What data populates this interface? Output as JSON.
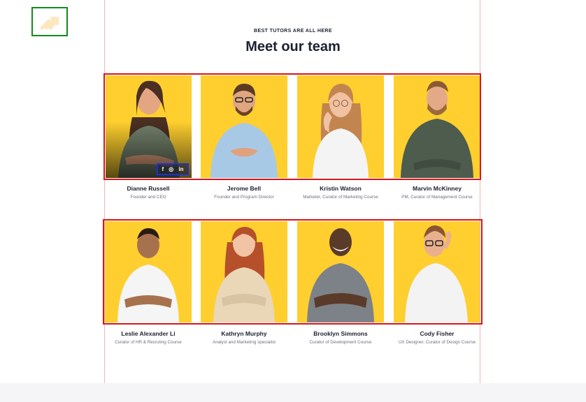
{
  "header": {
    "eyebrow": "BEST TUTORS ARE ALL HERE",
    "title": "Meet our team"
  },
  "team": [
    {
      "name": "Dianne Russell",
      "role": "Founder and CEO"
    },
    {
      "name": "Jerome Bell",
      "role": "Founder and Program Director"
    },
    {
      "name": "Kristin Watson",
      "role": "Marketer, Curator of Marketing Course"
    },
    {
      "name": "Marvin McKinney",
      "role": "PM, Curator of Management Course"
    },
    {
      "name": "Leslie Alexander Li",
      "role": "Curator of HR & Recruting Course"
    },
    {
      "name": "Kathryn Murphy",
      "role": "Analyst and Marketing specialist"
    },
    {
      "name": "Brooklyn Simmons",
      "role": "Curator of Development Course"
    },
    {
      "name": "Cody Fisher",
      "role": "UX Designer, Curator of Design Course"
    }
  ],
  "social": {
    "facebook": "f",
    "instagram": "◎",
    "linkedin": "in"
  },
  "colors": {
    "card_bg": "#fecf2e",
    "frame": "#d7151b",
    "logo_frame": "#138a1e",
    "social_frame": "#1a31d6"
  }
}
